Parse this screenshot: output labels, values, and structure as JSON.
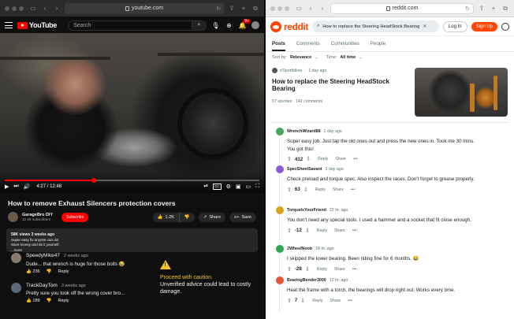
{
  "youtube": {
    "url": "youtube.com",
    "logo_text": "YouTube",
    "search_placeholder": "Search",
    "notification_count": "9+",
    "video": {
      "current_time": "4:27",
      "duration": "12:48",
      "progress": 0.35,
      "title": "How to remove Exhaust Silencers protection covers"
    },
    "channel": {
      "name": "GarageBro DIY",
      "subscribers": "12.4K subscribers",
      "subscribe_label": "Subscribe"
    },
    "actions": {
      "likes": "1.2K",
      "share": "Share",
      "save": "Save"
    },
    "description": {
      "meta": "58K views  3 weeks ago",
      "lines": [
        "Super easy fix anyone can do!",
        "Save money and do it yourself.",
        "...more"
      ]
    },
    "comments": [
      {
        "user": "SpeedyMike47",
        "when": "2 weeks ago",
        "text": "Dude... that wrench is huge for those bolts 😂",
        "likes": "236",
        "reply": "Reply",
        "avatar": "#8a7a6a"
      },
      {
        "user": "TrackDayTom",
        "when": "3 weeks ago",
        "text": "Pretty sure you took off the wrong cover bro...",
        "likes": "189",
        "reply": "Reply",
        "avatar": "#5a6a7a"
      }
    ],
    "warning": {
      "heading": "Proceed with caution.",
      "body": "Unverified advice could lead to costly damage."
    }
  },
  "reddit": {
    "url": "reddit.com",
    "logo_text": "reddit",
    "search_query": "How to replace the Steering HeadStock Bearing",
    "login": "Log In",
    "signup": "Sign Up",
    "tabs": [
      "Posts",
      "Comments",
      "Communities",
      "People"
    ],
    "sort": {
      "sort_label": "Sort by:",
      "sort_value": "Relevance",
      "time_label": "Time:",
      "time_value": "All time"
    },
    "post": {
      "subreddit": "r/Sportbikes",
      "when": "1 day ago",
      "title": "How to replace the Steering HeadStock Bearing",
      "upvotes": "67 upvotes",
      "comments": "142 comments"
    },
    "comments": [
      {
        "user": "WrenchWizard88",
        "when": "1 day ago",
        "text": "Super easy job. Just tap the old ones out and press the new ones in. Took me 30 mins. You got this!",
        "score": "412",
        "avatar": "#46a758"
      },
      {
        "user": "SpecSheetSavant",
        "when": "3 day ago",
        "text": "Check preload and torque spec. Also inspect the races. Don't forget to grease properly.",
        "score": "63",
        "avatar": "#8e5bd6"
      },
      {
        "user": "TorquelsYourFriend",
        "when": "22 hr. ago",
        "text": "You don't need any special tools. I used a hammer and a socket that fit close enough.",
        "score": "-12",
        "avatar": "#d9a21b"
      },
      {
        "user": "2WheelNoob",
        "when": "18 hr. ago",
        "text": "I skipped the lower bearing. Been riding fine for 6 months. 😂",
        "score": "-28",
        "avatar": "#2fa84f"
      },
      {
        "user": "BearingBender3000",
        "when": "12 hr. ago",
        "text": "Heat the frame with a torch, the bearings will drop right out. Works every time.",
        "score": "7",
        "avatar": "#e8543a"
      }
    ],
    "comment_actions": {
      "reply": "Reply",
      "share": "Share",
      "more": "•••"
    }
  }
}
